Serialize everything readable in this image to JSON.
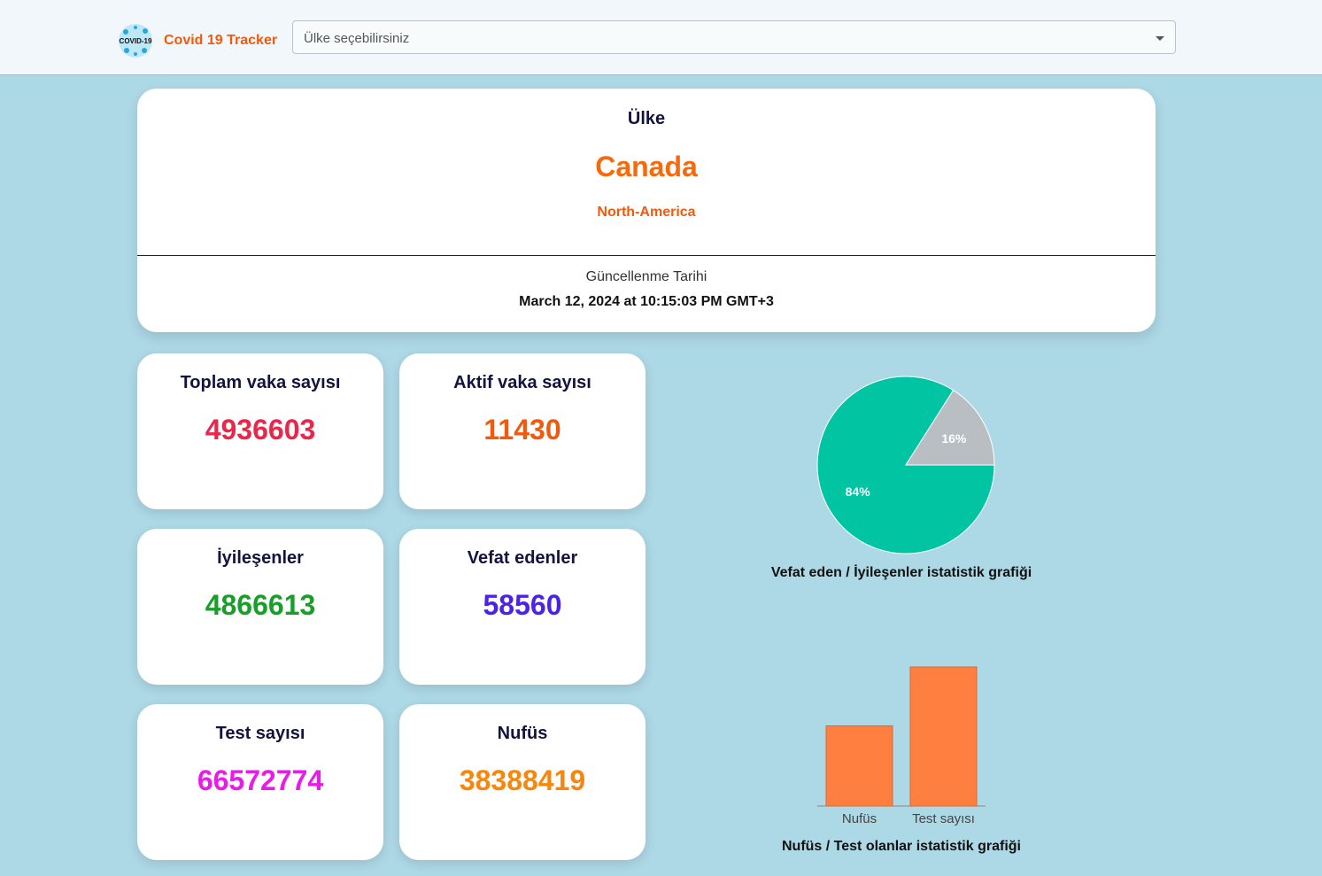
{
  "header": {
    "brand": "Covid 19 Tracker",
    "logo_text": "COVID-19",
    "select_placeholder": "Ülke seçebilirsiniz"
  },
  "country": {
    "title": "Ülke",
    "name": "Canada",
    "continent": "North-America",
    "updated_label": "Güncellenme Tarihi",
    "updated_date": "March 12, 2024 at 10:15:03 PM GMT+3"
  },
  "stats": [
    {
      "title": "Toplam vaka sayısı",
      "value": "4936603",
      "color": "#e8274a"
    },
    {
      "title": "Aktif vaka sayısı",
      "value": "11430",
      "color": "#f05a0d"
    },
    {
      "title": "İyileşenler",
      "value": "4866613",
      "color": "#1a9e2a"
    },
    {
      "title": "Vefat edenler",
      "value": "58560",
      "color": "#4b22e6"
    },
    {
      "title": "Test sayısı",
      "value": "66572774",
      "color": "#e81ce8"
    },
    {
      "title": "Nufüs",
      "value": "38388419",
      "color": "#f7860d"
    }
  ],
  "chart_data": [
    {
      "type": "pie",
      "title": "Vefat eden / İyileşenler istatistik grafiği",
      "slices": [
        {
          "label": "84%",
          "value": 84,
          "color": "#00c4a2"
        },
        {
          "label": "16%",
          "value": 16,
          "color": "#b9bec3"
        }
      ]
    },
    {
      "type": "bar",
      "title": "Nufüs / Test olanlar istatistik grafiği",
      "categories": [
        "Nufüs",
        "Test sayısı"
      ],
      "values": [
        38388419,
        66572774
      ],
      "color": "#ff7f41"
    }
  ]
}
